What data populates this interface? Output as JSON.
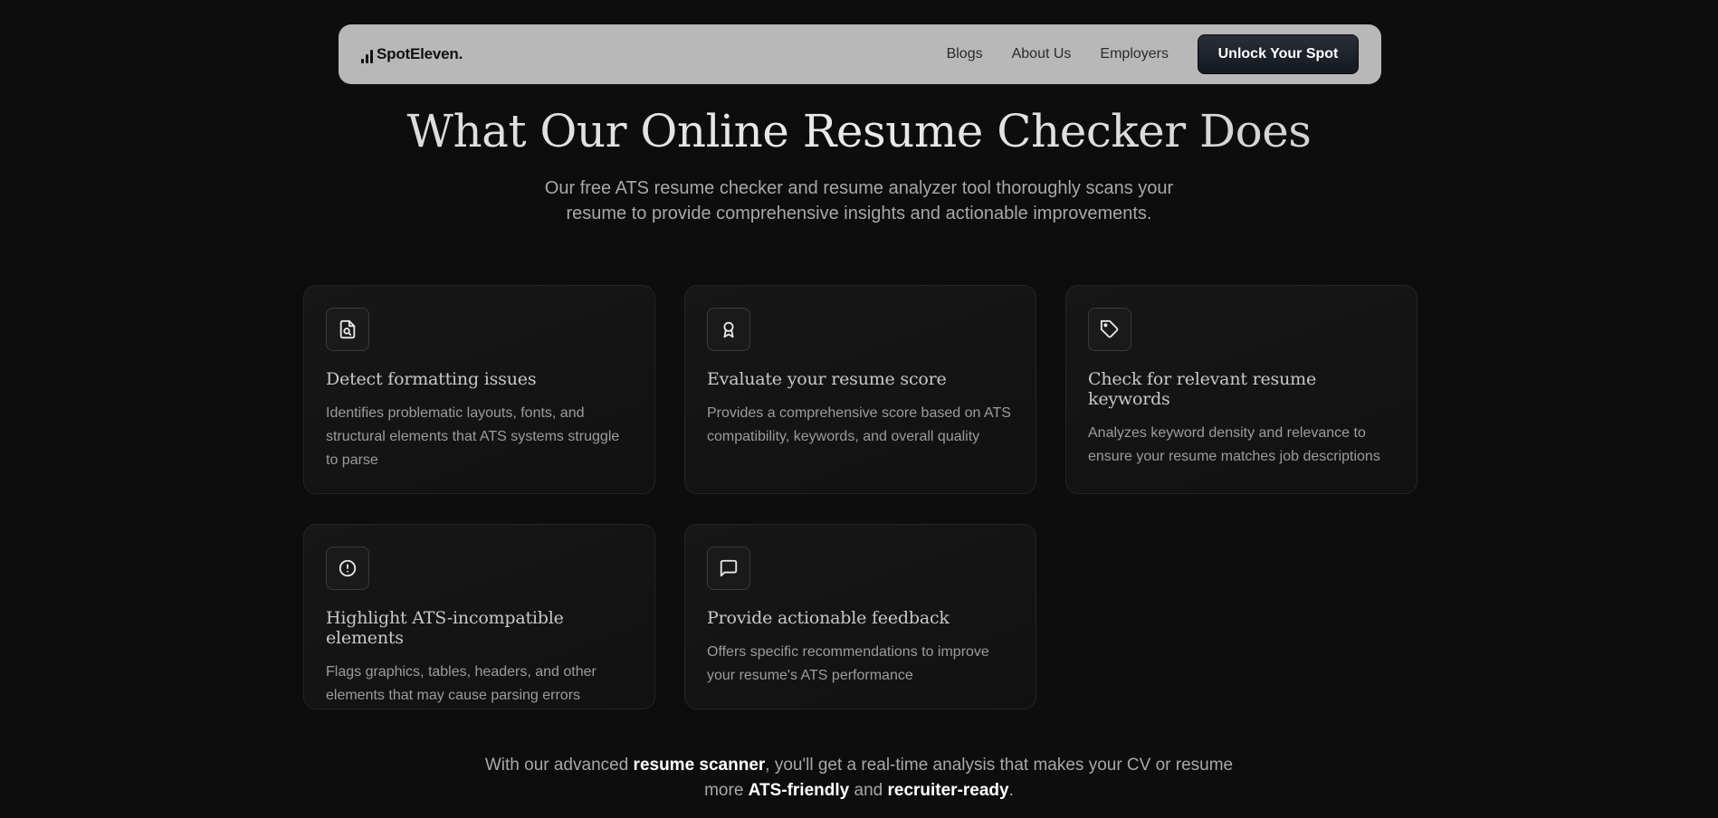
{
  "nav": {
    "brand": "SpotEleven.",
    "links": [
      "Blogs",
      "About Us",
      "Employers"
    ],
    "cta": "Unlock Your Spot"
  },
  "hero": {
    "title": "What Our Online Resume Checker Does",
    "subtitle": "Our free ATS resume checker and resume analyzer tool thoroughly scans your resume to provide comprehensive insights and actionable improvements."
  },
  "features": [
    {
      "icon": "file-search-icon",
      "title": "Detect formatting issues",
      "description": "Identifies problematic layouts, fonts, and structural elements that ATS systems struggle to parse"
    },
    {
      "icon": "award-icon",
      "title": "Evaluate your resume score",
      "description": "Provides a comprehensive score based on ATS compatibility, keywords, and overall quality"
    },
    {
      "icon": "tag-icon",
      "title": "Check for relevant resume keywords",
      "description": "Analyzes keyword density and relevance to ensure your resume matches job descriptions"
    },
    {
      "icon": "alert-circle-icon",
      "title": "Highlight ATS-incompatible elements",
      "description": "Flags graphics, tables, headers, and other elements that may cause parsing errors"
    },
    {
      "icon": "message-square-icon",
      "title": "Provide actionable feedback",
      "description": "Offers specific recommendations to improve your resume's ATS performance"
    }
  ],
  "footer": {
    "part1": "With our advanced ",
    "bold1": "resume scanner",
    "part2": ", you'll get a real-time analysis that makes your CV or resume more ",
    "bold2": "ATS-friendly",
    "part3": " and ",
    "bold3": "recruiter-ready",
    "part4": "."
  }
}
